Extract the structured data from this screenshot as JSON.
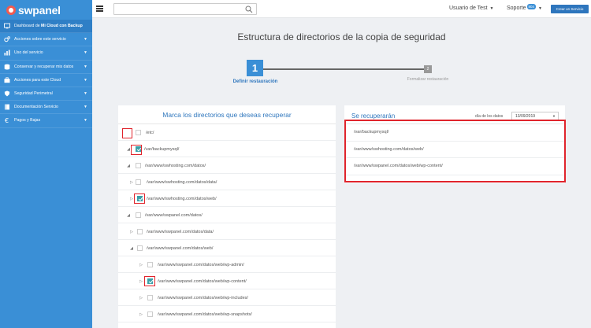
{
  "app": {
    "brand": "swpanel"
  },
  "sidebar": {
    "items": [
      {
        "label_pre": "Dashboard de ",
        "label_bold": "Mi Cloud con Backup",
        "icon": "dashboard-icon",
        "chevron": false
      },
      {
        "label_pre": "Acciones sobre este servicio",
        "label_bold": "",
        "icon": "gears-icon",
        "chevron": true
      },
      {
        "label_pre": "Uso del servicio",
        "label_bold": "",
        "icon": "chart-icon",
        "chevron": true
      },
      {
        "label_pre": "Conservar y recuperar mis datos",
        "label_bold": "",
        "icon": "database-icon",
        "chevron": true
      },
      {
        "label_pre": "Acciones para este Cloud",
        "label_bold": "",
        "icon": "briefcase-icon",
        "chevron": true
      },
      {
        "label_pre": "Seguridad Perimetral",
        "label_bold": "",
        "icon": "shield-icon",
        "chevron": true
      },
      {
        "label_pre": "Documentación Servicio",
        "label_bold": "",
        "icon": "book-icon",
        "chevron": true
      },
      {
        "label_pre": "Pagos y Bajas",
        "label_bold": "",
        "icon": "euro-icon",
        "chevron": true
      }
    ]
  },
  "topbar": {
    "search_placeholder": "",
    "user_label": "Usuario de Test",
    "support_label": "Soporte",
    "support_badge": "804",
    "create_button": "Crear un Servicio"
  },
  "page": {
    "title": "Estructura de directorios de la copia de seguridad",
    "steps": [
      {
        "number": "1",
        "label": "Definir restauración",
        "active": true
      },
      {
        "number": "2",
        "label": "Formalizar restauración",
        "active": false
      }
    ]
  },
  "left_panel": {
    "title": "Marca los directorios que deseas recuperar",
    "rows": [
      {
        "path": "/etc/",
        "checked": false,
        "expander": "",
        "highlighted": true
      },
      {
        "path": "/var/backupmysql/",
        "checked": true,
        "expander": "open",
        "highlighted": true
      },
      {
        "path": "/var/www/swhosting.com/datos/",
        "checked": false,
        "expander": "open",
        "highlighted": false
      },
      {
        "path": "/var/www/swhosting.com/datos/data/",
        "checked": false,
        "expander": "closed",
        "highlighted": false
      },
      {
        "path": "/var/www/swhosting.com/datos/web/",
        "checked": true,
        "expander": "closed",
        "highlighted": true
      },
      {
        "path": "/var/www/swpanel.com/datos/",
        "checked": false,
        "expander": "open",
        "highlighted": false
      },
      {
        "path": "/var/www/swpanel.com/datos/data/",
        "checked": false,
        "expander": "closed",
        "highlighted": false
      },
      {
        "path": "/var/www/swpanel.com/datos/web/",
        "checked": false,
        "expander": "open",
        "highlighted": false
      },
      {
        "path": "/var/www/swpanel.com/datos/web/wp-admin/",
        "checked": false,
        "expander": "closed",
        "highlighted": false
      },
      {
        "path": "/var/www/swpanel.com/datos/web/wp-content/",
        "checked": true,
        "expander": "closed",
        "highlighted": true
      },
      {
        "path": "/var/www/swpanel.com/datos/web/wp-includes/",
        "checked": false,
        "expander": "closed",
        "highlighted": false
      },
      {
        "path": "/var/www/swpanel.com/datos/web/wp-snapshots/",
        "checked": false,
        "expander": "closed",
        "highlighted": false
      }
    ]
  },
  "right_panel": {
    "title": "Se recuperarán",
    "date_label": "día de los datos",
    "date_value": "13/09/2019",
    "items": [
      "/var/backupmysql/",
      "/var/www/swhosting.com/datos/web/",
      "/var/www/swpanel.com/datos/web/wp-content/"
    ]
  },
  "colors": {
    "sidebar": "#3a8fd6",
    "accent": "#2e76bd",
    "highlight": "#e0242c",
    "checked": "#3aa0a8"
  }
}
